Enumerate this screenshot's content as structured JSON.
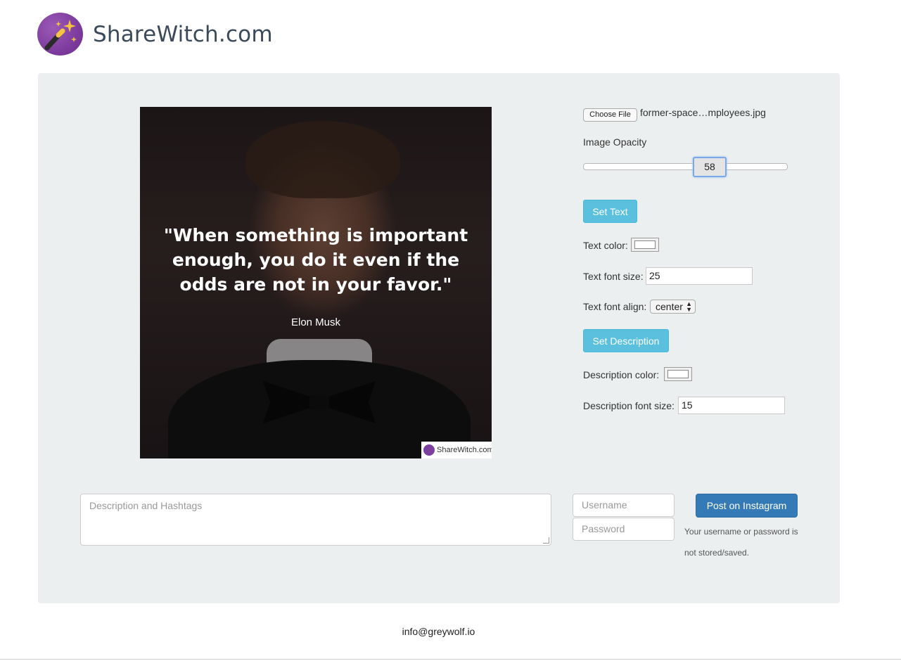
{
  "brand": {
    "name": "ShareWitch.com",
    "logo_icon": "magic-wand-icon"
  },
  "preview": {
    "quote": "\"When something is important enough, you do it even if the odds are not in your favor.\"",
    "author": "Elon Musk",
    "watermark": "ShareWitch.com"
  },
  "controls": {
    "choose_file_label": "Choose File",
    "file_name": "former-space…mployees.jpg",
    "opacity_label": "Image Opacity",
    "opacity_value": "58",
    "set_text_label": "Set Text",
    "text_color_label": "Text color:",
    "text_color": "#ffffff",
    "text_font_size_label": "Text font size:",
    "text_font_size": "25",
    "text_font_align_label": "Text font align:",
    "text_font_align": "center",
    "set_description_label": "Set Description",
    "description_color_label": "Description color:",
    "description_color": "#ffffff",
    "description_font_size_label": "Description font size:",
    "description_font_size": "15"
  },
  "post": {
    "description_placeholder": "Description and Hashtags",
    "username_placeholder": "Username",
    "password_placeholder": "Password",
    "post_button": "Post on Instagram",
    "note": "Your username or password is not stored/saved."
  },
  "footer": {
    "email": "info@greywolf.io"
  },
  "colors": {
    "panel": "#ecefef",
    "info": "#5bc0de",
    "primary": "#337ab7",
    "brand": "#7b3fa0"
  }
}
